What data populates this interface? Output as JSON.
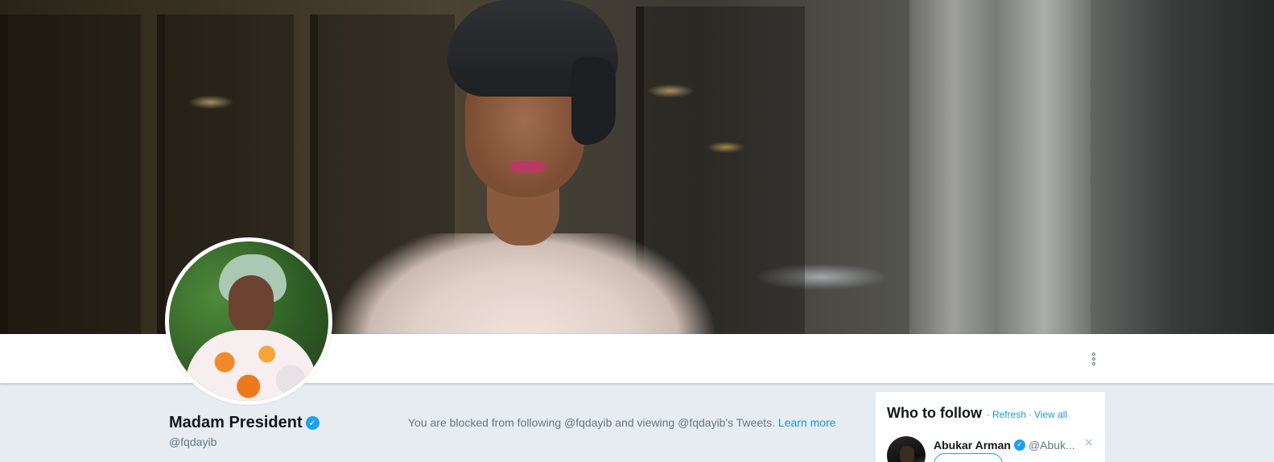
{
  "profile": {
    "display_name": "Madam President",
    "handle": "@fqdayib",
    "verified_icon": "verified-badge-icon",
    "verified_glyph": "✓"
  },
  "nav": {
    "more_icon": "more-vertical-icon"
  },
  "blocked_notice": {
    "text": "You are blocked from following @fqdayib and viewing @fqdayib's Tweets.",
    "learn_more": "Learn more"
  },
  "who_to_follow": {
    "title": "Who to follow",
    "separator": "·",
    "refresh": "Refresh",
    "view_all": "View all",
    "suggestions": [
      {
        "name": "Abukar Arman",
        "handle": "@Abuk...",
        "verified": true,
        "dismiss": "×"
      }
    ]
  },
  "colors": {
    "background": "#e6ecf0",
    "link": "#1b95e0",
    "verified": "#1da1f2",
    "text_primary": "#14171a",
    "text_secondary": "#657786"
  }
}
